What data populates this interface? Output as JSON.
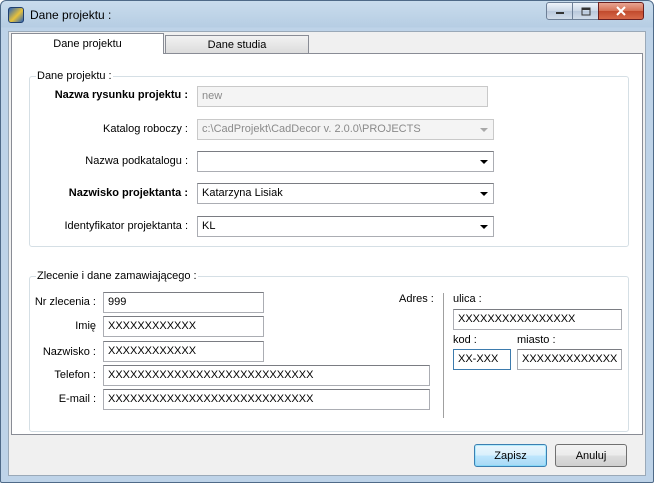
{
  "window": {
    "title": "Dane projektu :"
  },
  "tabs": [
    {
      "label": "Dane projektu",
      "active": true
    },
    {
      "label": "Dane studia",
      "active": false
    }
  ],
  "project": {
    "legend": "Dane projektu :",
    "drawing_name_label": "Nazwa rysunku projektu :",
    "drawing_name_value": "new",
    "working_dir_label": "Katalog roboczy :",
    "working_dir_value": "c:\\CadProjekt\\CadDecor v. 2.0.0\\PROJECTS",
    "subdir_label": "Nazwa podkatalogu :",
    "subdir_value": "",
    "designer_label": "Nazwisko projektanta :",
    "designer_value": "Katarzyna Lisiak",
    "designer_id_label": "Identyfikator projektanta :",
    "designer_id_value": "KL"
  },
  "order": {
    "legend": "Zlecenie i dane zamawiającego :",
    "order_no_label": "Nr zlecenia :",
    "order_no_value": "999",
    "first_name_label": "Imię",
    "first_name_value": "XXXXXXXXXXXX",
    "last_name_label": "Nazwisko :",
    "last_name_value": "XXXXXXXXXXXX",
    "phone_label": "Telefon :",
    "phone_value": "XXXXXXXXXXXXXXXXXXXXXXXXXXXX",
    "email_label": "E-mail :",
    "email_value": "XXXXXXXXXXXXXXXXXXXXXXXXXXXX",
    "address_label": "Adres :",
    "street_label": "ulica :",
    "street_value": "XXXXXXXXXXXXXXXX",
    "postcode_label": "kod :",
    "postcode_value": "XX-XXX",
    "city_label": "miasto :",
    "city_value": "XXXXXXXXXXXXX"
  },
  "buttons": {
    "save": "Zapisz",
    "cancel": "Anuluj"
  }
}
